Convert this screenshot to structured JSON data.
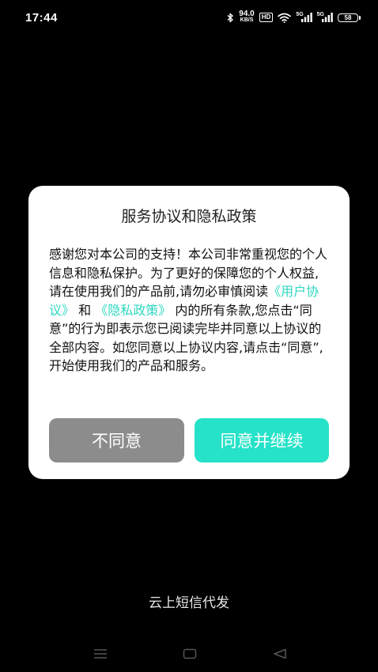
{
  "status_bar": {
    "time": "17:44",
    "net_speed_value": "94.0",
    "net_speed_unit": "KB/S",
    "hd_label": "HD",
    "sim1_label": "5G",
    "sim2_label": "5G",
    "battery_level": "58",
    "icons": [
      "bluetooth-icon",
      "wifi-icon",
      "signal-icon",
      "signal-icon",
      "battery-icon"
    ]
  },
  "dialog": {
    "title": "服务协议和隐私政策",
    "body_part1": "感谢您对本公司的支持！本公司非常重视您的个人信息和隐私保护。为了更好的保障您的个人权益,请在使用我们的产品前,请勿必审慎阅读",
    "link_user_agreement": "《用户协议》",
    "body_and": "和",
    "link_privacy_policy": "《隐私政策》",
    "body_part2": "内的所有条款,您点击“同意”的行为即表示您已阅读完毕并同意以上协议的全部内容。如您同意以上协议内容,请点击“同意”,开始使用我们的产品和服务。",
    "disagree_label": "不同意",
    "agree_label": "同意并继续"
  },
  "app": {
    "name": "云上短信代发"
  },
  "nav_bar": {
    "icons": [
      "menu-icon",
      "home-icon",
      "back-icon"
    ]
  },
  "colors": {
    "background": "#000000",
    "dialog_bg": "#ffffff",
    "accent": "#26e2c8",
    "link": "#2fd8c0",
    "disagree_bg": "#8c8c8c"
  }
}
